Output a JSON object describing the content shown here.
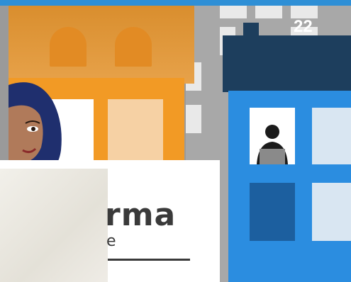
{
  "slide": {
    "number": "22"
  },
  "logo": {
    "word": "rma",
    "subtitle": "e"
  },
  "colors": {
    "accent_blue": "#2e8fd6",
    "house_orange": "#f29a25",
    "building_blue": "#2b8de0",
    "roof_dark": "#1d3e5d"
  }
}
